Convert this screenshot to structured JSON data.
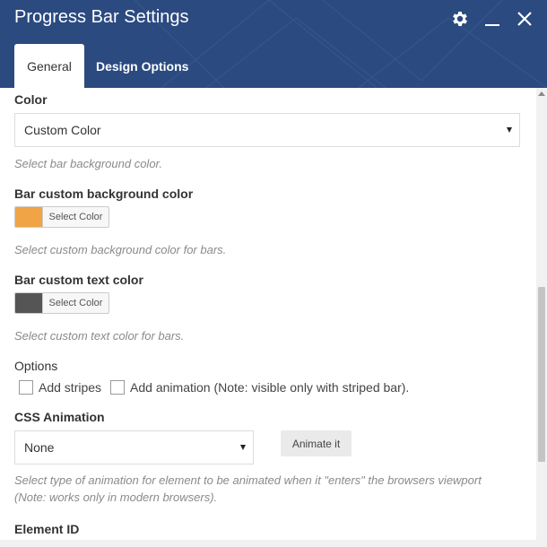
{
  "header": {
    "title": "Progress Bar Settings",
    "icons": [
      "gear-icon",
      "minimize-icon",
      "close-icon"
    ],
    "bg_color": "#2b4a80"
  },
  "tabs": [
    {
      "label": "General",
      "active": true
    },
    {
      "label": "Design Options",
      "active": false
    }
  ],
  "fields": {
    "color": {
      "label": "Color",
      "value": "Custom Color",
      "help": "Select bar background color."
    },
    "bar_bg": {
      "label": "Bar custom background color",
      "button": "Select Color",
      "swatch": "#f0a445",
      "help": "Select custom background color for bars."
    },
    "bar_text": {
      "label": "Bar custom text color",
      "button": "Select Color",
      "swatch": "#555555",
      "help": "Select custom text color for bars."
    },
    "options": {
      "label": "Options",
      "stripes": "Add stripes",
      "animation": "Add animation (Note: visible only with striped bar)."
    },
    "css_animation": {
      "label": "CSS Animation",
      "value": "None",
      "button": "Animate it",
      "help_line1": "Select type of animation for element to be animated when it \"enters\" the browsers viewport",
      "help_line2": "(Note: works only in modern browsers)."
    },
    "element_id": {
      "label": "Element ID"
    }
  }
}
